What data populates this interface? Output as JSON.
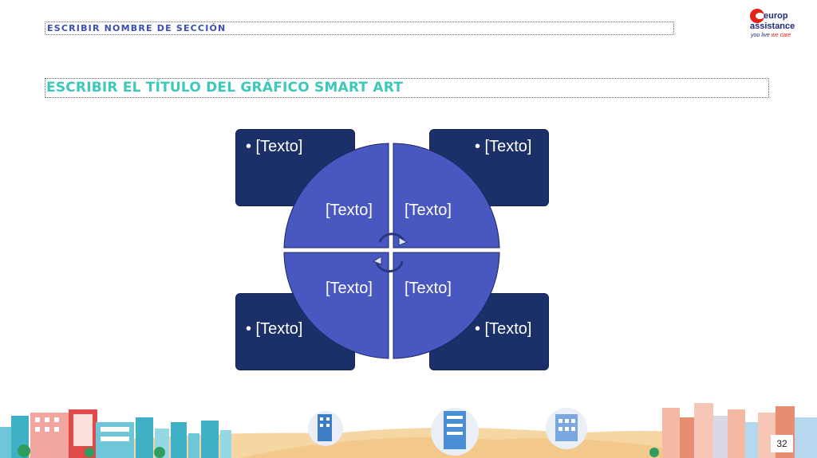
{
  "header": {
    "section_label": "ESCRIBIR NOMBRE DE SECCIÓN",
    "title": "ESCRIBIR EL TÍTULO DEL GRÁFICO SMART ART"
  },
  "logo": {
    "line1": "europ",
    "line2": "assistance",
    "tagline_a": "you live ",
    "tagline_b": "we care"
  },
  "smartart": {
    "outer_top_left": "•  [Texto]",
    "outer_top_right": "•  [Texto]",
    "outer_bottom_left": "•  [Texto]",
    "outer_bottom_right": "•  [Texto]",
    "wedge_top_left": "[Texto]",
    "wedge_top_right": "[Texto]",
    "wedge_bottom_left": "[Texto]",
    "wedge_bottom_right": "[Texto]"
  },
  "footer": {
    "page_number": "32"
  },
  "colors": {
    "box_fill": "#1b2f68",
    "wedge_fill": "#4858c0",
    "title_color": "#3cc8bb",
    "section_color": "#3a4fb0"
  }
}
